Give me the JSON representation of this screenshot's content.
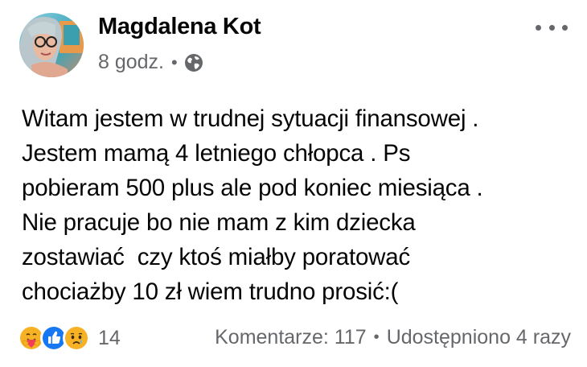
{
  "author": {
    "name": "Magdalena Kot",
    "time": "8 godz.",
    "separator": "•",
    "audience_icon": "globe-icon"
  },
  "post": {
    "text": "Witam jestem w trudnej sytuacji finansowej .\nJestem mamą 4 letniego chłopca . Ps\npobieram 500 plus ale pod koniec miesiąca .\nNie pracuje bo nie mam z kim dziecka\nzostawiać  czy ktoś miałby poratować\nchociażby 10 zł wiem trudno prosić:("
  },
  "reactions": {
    "icons": [
      "care-reaction-icon",
      "like-reaction-icon",
      "sad-reaction-icon"
    ],
    "count": "14"
  },
  "stats": {
    "comments": "Komentarze: 117",
    "separator": "•",
    "shares": "Udostępniono 4 razy"
  },
  "colors": {
    "text": "#050505",
    "secondary": "#65676b",
    "like_blue": "#1877f2",
    "reaction_yellow": "#f7b125"
  }
}
